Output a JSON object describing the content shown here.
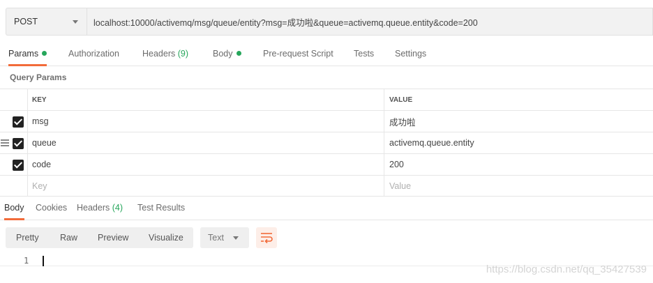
{
  "request": {
    "method": "POST",
    "url": "localhost:10000/activemq/msg/queue/entity?msg=成功啦&queue=activemq.queue.entity&code=200"
  },
  "request_tabs": {
    "params": "Params",
    "authorization": "Authorization",
    "headers": "Headers",
    "headers_count": "(9)",
    "body": "Body",
    "prerequest": "Pre-request Script",
    "tests": "Tests",
    "settings": "Settings"
  },
  "query_params": {
    "title": "Query Params",
    "key_header": "KEY",
    "value_header": "VALUE",
    "rows": [
      {
        "key": "msg",
        "value": "成功啦",
        "checked": true
      },
      {
        "key": "queue",
        "value": "activemq.queue.entity",
        "checked": true
      },
      {
        "key": "code",
        "value": "200",
        "checked": true
      }
    ],
    "key_placeholder": "Key",
    "value_placeholder": "Value"
  },
  "response_tabs": {
    "body": "Body",
    "cookies": "Cookies",
    "headers": "Headers",
    "headers_count": "(4)",
    "test_results": "Test Results"
  },
  "response_toolbar": {
    "pretty": "Pretty",
    "raw": "Raw",
    "preview": "Preview",
    "visualize": "Visualize",
    "format": "Text"
  },
  "editor": {
    "line_number": "1"
  },
  "watermark": "https://blog.csdn.net/qq_35427539",
  "colors": {
    "accent": "#f26b3a",
    "active_dot": "#26a65b"
  }
}
